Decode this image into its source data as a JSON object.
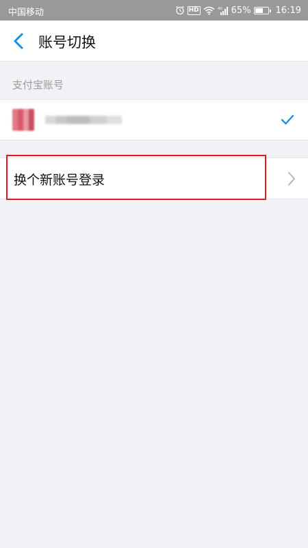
{
  "status_bar": {
    "carrier": "中国移动",
    "network_badge": "HD",
    "battery": "65%",
    "battery_level": 0.65,
    "time": "16:19",
    "icons": [
      "alarm-icon",
      "hd-icon",
      "wifi-icon",
      "signal-icon",
      "battery-icon"
    ]
  },
  "nav": {
    "title": "账号切换",
    "back_icon": "chevron-left-icon"
  },
  "section": {
    "header": "支付宝账号"
  },
  "account": {
    "selected": true,
    "check_icon": "checkmark-icon"
  },
  "switch_account": {
    "label": "换个新账号登录",
    "chevron_icon": "chevron-right-icon"
  },
  "colors": {
    "accent": "#1a8ee6",
    "highlight": "#e01a1a",
    "background": "#f2f2f6",
    "status_bar": "#999999"
  }
}
